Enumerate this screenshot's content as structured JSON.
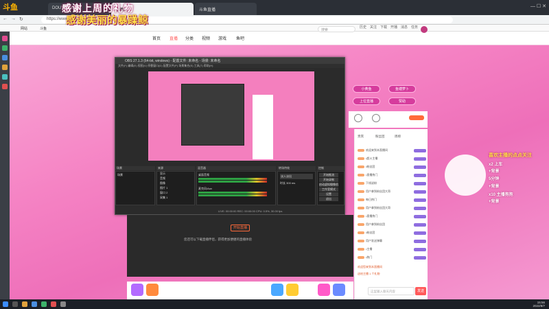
{
  "browser": {
    "tabs": [
      {
        "label": "DOUYU.COM"
      },
      {
        "label": "直播间"
      },
      {
        "label": "斗鱼直播"
      }
    ],
    "url": "https://www.douyu.com/",
    "bookmarks": [
      "网站",
      "斗鱼"
    ]
  },
  "banner": {
    "title": "感谢上周的礼物",
    "subtitle": "感谢美丽的暴躁鲸"
  },
  "site": {
    "logo": "斗鱼",
    "nav": [
      "首页",
      "直播",
      "分类",
      "视频",
      "游戏",
      "鱼吧"
    ],
    "active_nav": 1,
    "search_placeholder": "搜索",
    "header_icons": [
      "历史",
      "关注",
      "下载",
      "开播",
      "消息",
      "任务"
    ]
  },
  "obs": {
    "title": "OBS 27.1.3 (64-bit, windows) - 配置文件: 未命名 - 场景: 未命名",
    "menu": "文件(F)  编辑(E)  视图(V)  停靠窗口(D)  配置文件(P)  场景集合(S)  工具(T)  帮助(H)",
    "docks": [
      "场景",
      "来源",
      "混音器",
      "转场特效",
      "控制"
    ],
    "scenes": [
      "场景"
    ],
    "sources": [
      "显示",
      "音频",
      "图像",
      "图片 1",
      "窗口 2",
      "采集 1"
    ],
    "mixer_channels": [
      "桌面音频",
      "麦克风/Aux"
    ],
    "transition": {
      "label": "淡入淡出",
      "duration_label": "时长",
      "duration": "300 ms"
    },
    "controls": [
      "开始推流",
      "开始录制",
      "启动虚拟摄像机",
      "工作室模式",
      "设置",
      "退出"
    ],
    "status": "LIVE: 00:00:00   REC: 00:00:00   CPU: 0.5%, 30.00 fps"
  },
  "stream": {
    "live_button": "开始直播",
    "tip": "您还可以下载直播伴侣，获得更加便捷的直播体验"
  },
  "right_panel": {
    "buttons": [
      "小黄鱼",
      "鱼塘萝卜",
      "上位直播",
      "赞助"
    ],
    "rank_tabs": [
      "贵宾",
      "粉丝团",
      "周榜"
    ],
    "chat_rows": [
      "欢迎来到本直播间",
      "•超火主播",
      "•粉丝团",
      "•直播热门",
      "下线说粉",
      "用户拿到粉丝团大哥",
      "每日热门",
      "用户拿到粉丝团大哥",
      "•直播热门",
      "用户拿到粉丝团",
      "•粉丝团",
      "用户发送弹幕",
      "•主播",
      "•热门"
    ],
    "chat_notice": [
      "欢迎您来到本直播间",
      "送给主播 1 个礼物"
    ],
    "input_placeholder": "这里输入聊天内容",
    "send": "发送"
  },
  "follow_box": {
    "title": "喜欢主播的点点关注",
    "lines": [
      "x2 上车",
      "+背景",
      "5分钟",
      "+背景",
      "x10 主播抱抱",
      "+背景"
    ]
  },
  "taskbar": {
    "time": "15:56",
    "date": "2022/8/7"
  }
}
